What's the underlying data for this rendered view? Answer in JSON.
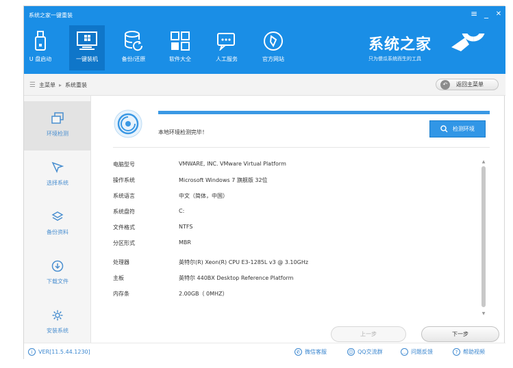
{
  "window": {
    "title": "系统之家一键重装",
    "controls": {
      "menu": "≡",
      "minimize": "_",
      "close": "✕"
    }
  },
  "nav": {
    "items": [
      {
        "label": "U 盘启动",
        "icon": "usb-drive-icon"
      },
      {
        "label": "一键装机",
        "icon": "monitor-windows-icon",
        "active": true
      },
      {
        "label": "备份/还原",
        "icon": "database-restore-icon"
      },
      {
        "label": "软件大全",
        "icon": "apps-grid-icon"
      },
      {
        "label": "人工服务",
        "icon": "chat-bubble-icon"
      },
      {
        "label": "官方网站",
        "icon": "compass-icon"
      }
    ]
  },
  "brand": {
    "title": "系统之家",
    "subtitle": "只为傻瓜系统而生的工具"
  },
  "breadcrumb": {
    "home": "主菜单",
    "separator": "▸",
    "current": "系统重装",
    "back_label": "返回主菜单"
  },
  "sidebar": {
    "items": [
      {
        "label": "环境检测",
        "icon": "copy-windows-icon",
        "active": true
      },
      {
        "label": "选择系统",
        "icon": "cursor-arrow-icon"
      },
      {
        "label": "备份资料",
        "icon": "layers-icon"
      },
      {
        "label": "下载文件",
        "icon": "download-circle-icon"
      },
      {
        "label": "安装系统",
        "icon": "gear-icon"
      }
    ]
  },
  "main": {
    "status_text": "本地环境检测完毕！",
    "progress_percent": 100,
    "detect_button": "检测环境",
    "info_rows": [
      {
        "key": "电脑型号",
        "value": "VMWARE, INC. VMware Virtual Platform"
      },
      {
        "key": "操作系统",
        "value": "Microsoft Windows 7 旗舰版  32位"
      },
      {
        "key": "系统语言",
        "value": "中文（简体，中国）"
      },
      {
        "key": "系统盘符",
        "value": "C:"
      },
      {
        "key": "文件格式",
        "value": "NTFS"
      },
      {
        "key": "分区形式",
        "value": "MBR"
      },
      {
        "key": "处理器",
        "value": "英特尔(R) Xeon(R) CPU E3-1285L v3 @ 3.10GHz"
      },
      {
        "key": "主板",
        "value": "英特尔 440BX Desktop Reference Platform"
      },
      {
        "key": "内存条",
        "value": "2.00GB（ 0MHZ）"
      }
    ],
    "prev_button": "上一步",
    "next_button": "下一步"
  },
  "footer": {
    "version": "VER[11.5.44.1230]",
    "links": [
      {
        "label": "微信客服",
        "icon": "wechat-icon"
      },
      {
        "label": "QQ交流群",
        "icon": "qq-icon"
      },
      {
        "label": "问题反馈",
        "icon": "feedback-icon"
      },
      {
        "label": "帮助视频",
        "icon": "help-icon"
      }
    ]
  },
  "colors": {
    "header_blue": "#1a8ee6",
    "active_nav": "#0f76c9",
    "accent_blue": "#3196e6",
    "sidebar_text": "#4a8fd0"
  }
}
